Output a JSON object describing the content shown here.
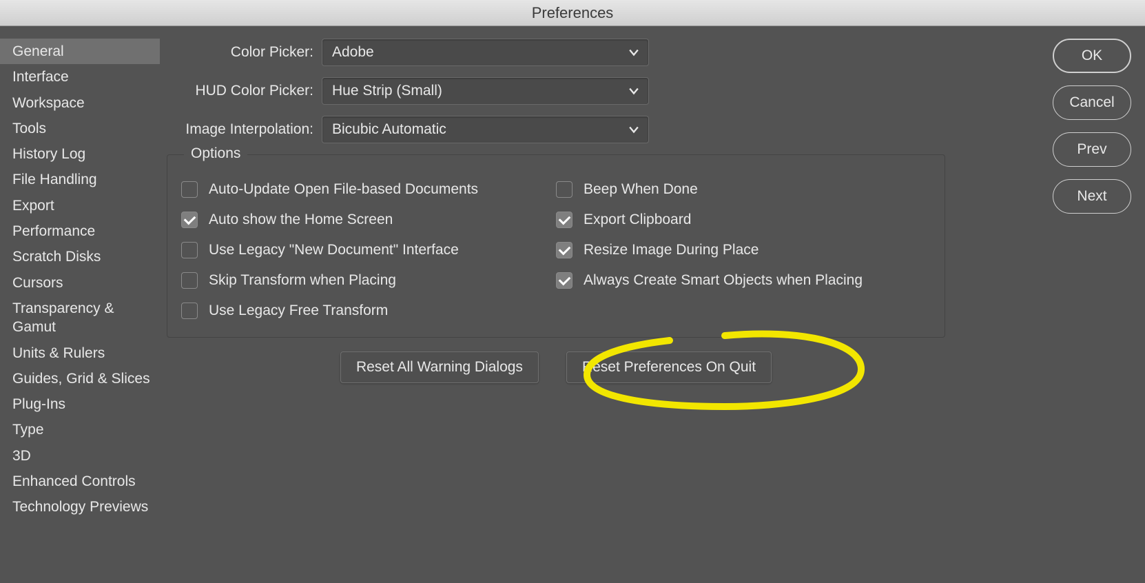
{
  "window": {
    "title": "Preferences"
  },
  "sidebar": {
    "items": [
      "General",
      "Interface",
      "Workspace",
      "Tools",
      "History Log",
      "File Handling",
      "Export",
      "Performance",
      "Scratch Disks",
      "Cursors",
      "Transparency & Gamut",
      "Units & Rulers",
      "Guides, Grid & Slices",
      "Plug-Ins",
      "Type",
      "3D",
      "Enhanced Controls",
      "Technology Previews"
    ],
    "selected_index": 0
  },
  "form": {
    "color_picker": {
      "label": "Color Picker:",
      "value": "Adobe"
    },
    "hud_color_picker": {
      "label": "HUD Color Picker:",
      "value": "Hue Strip (Small)"
    },
    "image_interpolation": {
      "label": "Image Interpolation:",
      "value": "Bicubic Automatic"
    }
  },
  "options": {
    "legend": "Options",
    "left": [
      {
        "label": "Auto-Update Open File-based Documents",
        "checked": false
      },
      {
        "label": "Auto show the Home Screen",
        "checked": true
      },
      {
        "label": "Use Legacy \"New Document\" Interface",
        "checked": false
      },
      {
        "label": "Skip Transform when Placing",
        "checked": false
      },
      {
        "label": "Use Legacy Free Transform",
        "checked": false
      }
    ],
    "right": [
      {
        "label": "Beep When Done",
        "checked": false
      },
      {
        "label": "Export Clipboard",
        "checked": true
      },
      {
        "label": "Resize Image During Place",
        "checked": true
      },
      {
        "label": "Always Create Smart Objects when Placing",
        "checked": true
      }
    ]
  },
  "reset": {
    "warning": "Reset All Warning Dialogs",
    "prefs": "Reset Preferences On Quit"
  },
  "actions": {
    "ok": "OK",
    "cancel": "Cancel",
    "prev": "Prev",
    "next": "Next"
  }
}
